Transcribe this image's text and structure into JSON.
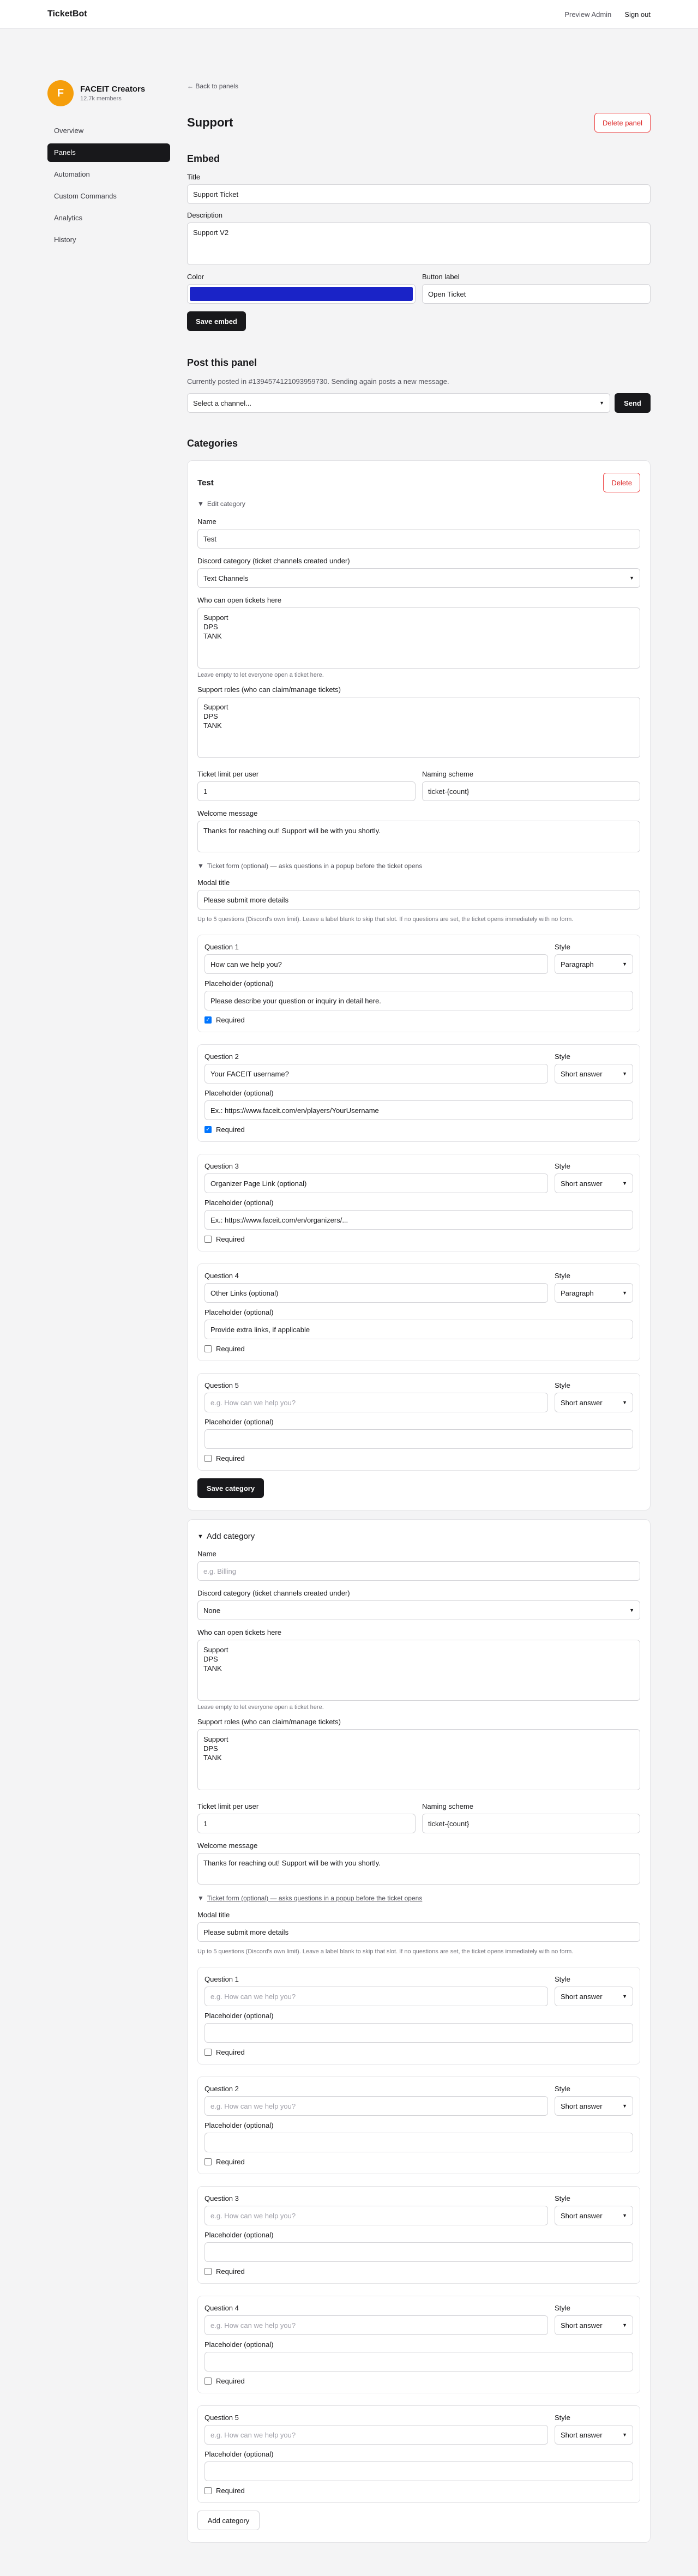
{
  "topbar": {
    "brand": "TicketBot",
    "preview": "Preview Admin",
    "signout": "Sign out"
  },
  "guild": {
    "initial": "F",
    "name": "FACEIT Creators",
    "members": "12.7k members"
  },
  "nav": [
    "Overview",
    "Panels",
    "Automation",
    "Custom Commands",
    "Analytics",
    "History"
  ],
  "back": "← Back to panels",
  "page_title": "Support",
  "delete_panel": "Delete panel",
  "embed": {
    "heading": "Embed",
    "title_label": "Title",
    "title_value": "Support Ticket",
    "desc_label": "Description",
    "desc_value": "Support V2",
    "color_label": "Color",
    "color_value": "#1a23c7",
    "button_label": "Button label",
    "button_value": "Open Ticket",
    "save": "Save embed"
  },
  "post": {
    "heading": "Post this panel",
    "info": "Currently posted in #1394574121093959730. Sending again posts a new message.",
    "select": "Select a channel...",
    "send": "Send"
  },
  "categories_heading": "Categories",
  "cat": {
    "name": "Test",
    "delete": "Delete",
    "edit": "Edit category",
    "name_label": "Name",
    "name_value": "Test",
    "disc_label": "Discord category (ticket channels created under)",
    "disc_value": "Text Channels",
    "who_label": "Who can open tickets here",
    "who_value": "Support\nDPS\nTANK",
    "who_hint": "Leave empty to let everyone open a ticket here.",
    "roles_label": "Support roles (who can claim/manage tickets)",
    "roles_value": "Support\nDPS\nTANK",
    "limit_label": "Ticket limit per user",
    "limit_value": "1",
    "naming_label": "Naming scheme",
    "naming_value": "ticket-{count}",
    "welcome_label": "Welcome message",
    "welcome_value": "Thanks for reaching out! Support will be with you shortly.",
    "form_summary": "Ticket form (optional) — asks questions in a popup before the ticket opens",
    "modal_label": "Modal title",
    "modal_value": "Please submit more details",
    "form_hint": "Up to 5 questions (Discord's own limit). Leave a label blank to skip that slot. If no questions are set, the ticket opens immediately with no form.",
    "questions": [
      {
        "label": "Question 1",
        "value": "How can we help you?",
        "placeholder": "Please describe your question or inquiry in detail here.",
        "style": "Paragraph",
        "required": true
      },
      {
        "label": "Question 2",
        "value": "Your FACEIT username?",
        "placeholder": "Ex.: https://www.faceit.com/en/players/YourUsername",
        "style": "Short answer",
        "required": true
      },
      {
        "label": "Question 3",
        "value": "Organizer Page Link (optional)",
        "placeholder": "Ex.: https://www.faceit.com/en/organizers/...",
        "style": "Short answer",
        "required": false
      },
      {
        "label": "Question 4",
        "value": "Other Links (optional)",
        "placeholder": "Provide extra links, if applicable",
        "style": "Paragraph",
        "required": false
      },
      {
        "label": "Question 5",
        "value": "",
        "placeholder": "",
        "style": "Short answer",
        "required": false
      }
    ],
    "q_hint": "e.g. How can we help you?",
    "style_label": "Style",
    "ph_label": "Placeholder (optional)",
    "required_label": "Required",
    "save": "Save category"
  },
  "add": {
    "heading": "Add category",
    "name_label": "Name",
    "name_ph": "e.g. Billing",
    "disc_label": "Discord category (ticket channels created under)",
    "disc_value": "None",
    "who_label": "Who can open tickets here",
    "who_value": "Support\nDPS\nTANK",
    "who_hint": "Leave empty to let everyone open a ticket here.",
    "roles_label": "Support roles (who can claim/manage tickets)",
    "roles_value": "Support\nDPS\nTANK",
    "limit_label": "Ticket limit per user",
    "limit_value": "1",
    "naming_label": "Naming scheme",
    "naming_value": "ticket-{count}",
    "welcome_label": "Welcome message",
    "welcome_value": "Thanks for reaching out! Support will be with you shortly.",
    "form_summary": "Ticket form (optional) — asks questions in a popup before the ticket opens",
    "modal_label": "Modal title",
    "modal_value": "Please submit more details",
    "form_hint": "Up to 5 questions (Discord's own limit). Leave a label blank to skip that slot. If no questions are set, the ticket opens immediately with no form.",
    "q_ph": "e.g. How can we help you?",
    "style_value": "Short answer",
    "questions": [
      "Question 1",
      "Question 2",
      "Question 3",
      "Question 4",
      "Question 5"
    ],
    "submit": "Add category"
  },
  "colors": {
    "accent": "#18181b",
    "danger": "#dc2626",
    "checkbox": "#0075ff",
    "avatar": "#f59e0b"
  }
}
